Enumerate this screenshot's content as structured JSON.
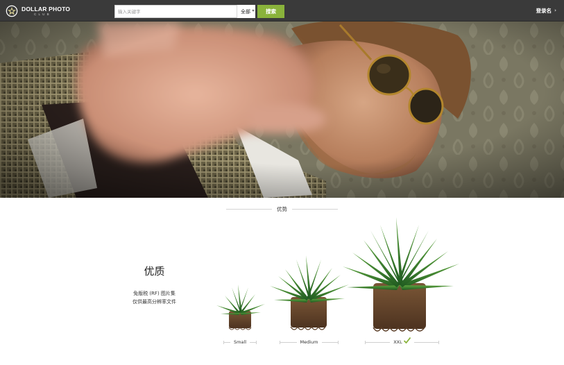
{
  "header": {
    "logo": {
      "name": "DOLLAR PHOTO",
      "tagline": "CLUB",
      "icon": "star-aperture-icon"
    },
    "search": {
      "placeholder": "输入关键字",
      "value": "",
      "scope_selected": "全部",
      "button_label": "搜索"
    },
    "login_label": "登录名",
    "login_icon": "chevron-right-icon"
  },
  "hero": {
    "image": "man with sunglasses and raised blurred hand in front of patterned wallpaper"
  },
  "advantages": {
    "heading": "优势",
    "feature": {
      "title": "优质",
      "desc_line1": "免版税 (RF) 图片集",
      "desc_line2": "仅供最高分辨率文件"
    },
    "sizes": [
      {
        "label": "Small",
        "selected": false
      },
      {
        "label": "Medium",
        "selected": false
      },
      {
        "label": "XXL",
        "selected": true
      }
    ]
  },
  "colors": {
    "topbar_bg": "#3a3a3a",
    "accent_green": "#8ab33b",
    "plant_green": "#2f7a2a",
    "soil_brown": "#6b4a32"
  }
}
